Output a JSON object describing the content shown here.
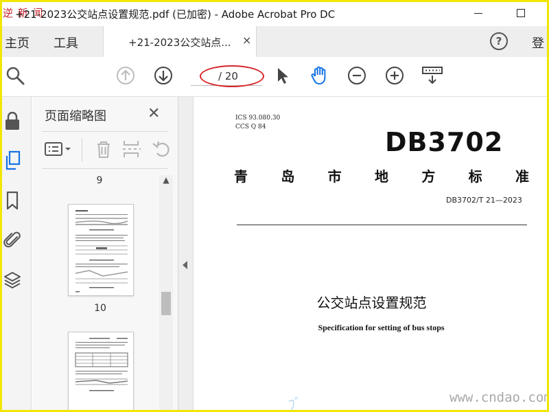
{
  "app_logo": "逆 新 闻",
  "window": {
    "title": "+21-2023公交站点设置规范.pdf  (已加密)  - Adobe Acrobat Pro DC"
  },
  "tabs": {
    "home": "主页",
    "tools": "工具",
    "document": "+21-2023公交站点...",
    "close_icon": "×"
  },
  "header_right": {
    "help": "?",
    "signin": "登"
  },
  "toolbar": {
    "page_current": "",
    "page_total": "/ 20",
    "icons": [
      "search-icon",
      "prev-page-icon",
      "next-page-icon",
      "select-pointer-icon",
      "hand-tool-icon",
      "zoom-out-icon",
      "zoom-in-icon",
      "keyboard-tool-icon"
    ]
  },
  "panel": {
    "title": "页面缩略图",
    "close": "✕",
    "thumbnails": [
      {
        "label": "9"
      },
      {
        "label": "10"
      }
    ]
  },
  "document": {
    "ics": "ICS  93.080.30",
    "ccs": "CCS  Q 84",
    "db_code": "DB3702",
    "region_chars": [
      "青",
      "岛",
      "市",
      "地",
      "方",
      "标",
      "准"
    ],
    "standard_number": "DB3702/T  21—2023",
    "title_cn": "公交站点设置规范",
    "title_en": "Specification for setting of bus stops"
  },
  "watermark": "www.cndao.com",
  "colors": {
    "accent_blue": "#1473e6",
    "annotation_red": "#d6252b",
    "frame_yellow": "#f2e600"
  }
}
